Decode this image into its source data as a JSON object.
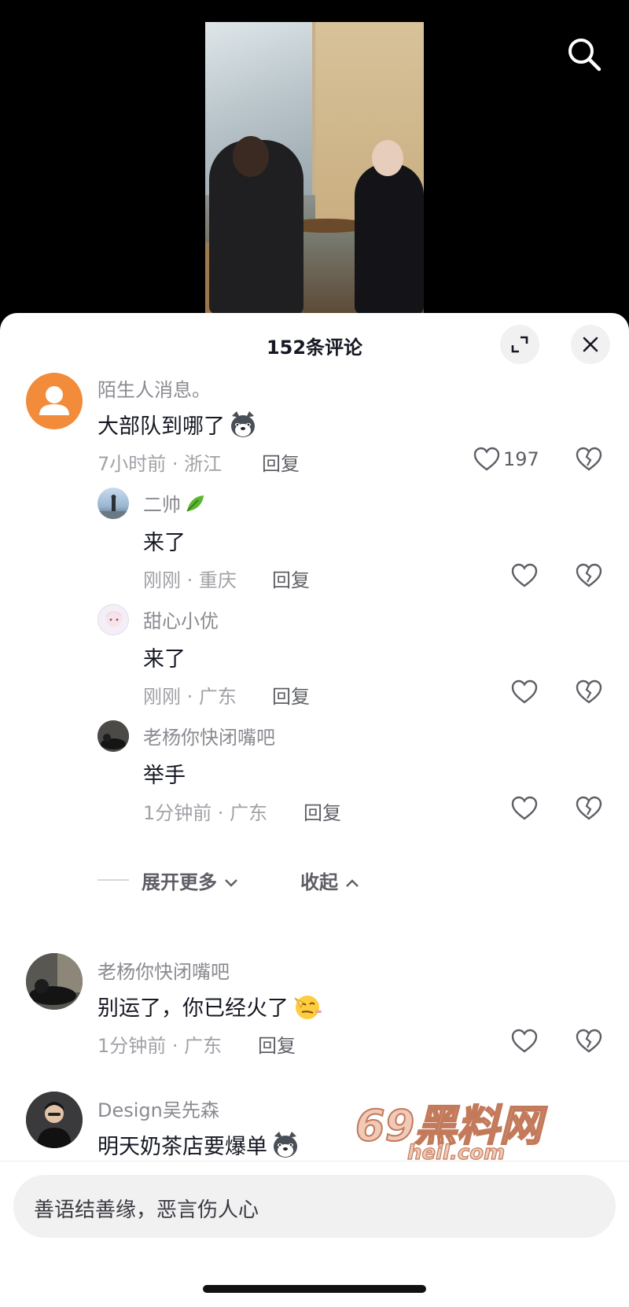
{
  "header": {
    "title": "152条评论",
    "expand_icon": "expand-icon",
    "close_icon": "close-icon",
    "search_icon": "search-icon"
  },
  "comments": [
    {
      "name": "陌生人消息。",
      "text": "大部队到哪了",
      "emoji": "husky-emoji",
      "meta": "7小时前 · 浙江",
      "reply": "回复",
      "likes": "197",
      "avatar": "default-avatar"
    },
    {
      "name": "二帅",
      "name_emoji": "leaf-emoji",
      "text": "来了",
      "meta": "刚刚 · 重庆",
      "reply": "回复"
    },
    {
      "name": "甜心小优",
      "text": "来了",
      "meta": "刚刚 · 广东",
      "reply": "回复"
    },
    {
      "name": "老杨你快闭嘴吧",
      "text": "举手",
      "meta": "1分钟前 · 广东",
      "reply": "回复"
    },
    {
      "name": "老杨你快闭嘴吧",
      "text": "别运了，你已经火了",
      "emoji": "salute-emoji",
      "meta": "1分钟前 · 广东",
      "reply": "回复"
    },
    {
      "name": "Design吴先森",
      "text": "明天奶茶店要爆单",
      "emoji": "husky-emoji"
    }
  ],
  "expand": {
    "more": "展开更多",
    "collapse": "收起"
  },
  "input": {
    "placeholder": "善语结善缘，恶言伤人心"
  },
  "watermark": {
    "line1": "69黑料网",
    "line2": "heil.com"
  },
  "colors": {
    "sheet_bg": "#ffffff",
    "avatar_orange": "#f28c3a",
    "text_primary": "#161823",
    "text_secondary": "#8a8b91"
  }
}
